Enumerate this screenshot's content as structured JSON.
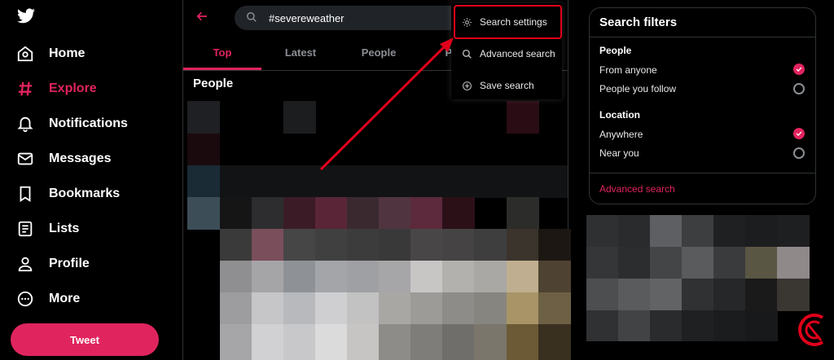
{
  "nav": {
    "items": [
      {
        "label": "Home",
        "icon": "home-icon"
      },
      {
        "label": "Explore",
        "icon": "hashtag-icon",
        "active": true
      },
      {
        "label": "Notifications",
        "icon": "bell-icon"
      },
      {
        "label": "Messages",
        "icon": "envelope-icon"
      },
      {
        "label": "Bookmarks",
        "icon": "bookmark-icon"
      },
      {
        "label": "Lists",
        "icon": "list-icon"
      },
      {
        "label": "Profile",
        "icon": "profile-icon"
      },
      {
        "label": "More",
        "icon": "more-icon"
      }
    ],
    "tweet_label": "Tweet"
  },
  "search": {
    "value": "#severeweather"
  },
  "tabs": [
    {
      "label": "Top",
      "active": true
    },
    {
      "label": "Latest"
    },
    {
      "label": "People"
    },
    {
      "label": "Phot"
    }
  ],
  "main": {
    "section_title": "People"
  },
  "menu": {
    "items": [
      {
        "label": "Search settings",
        "icon": "gear-icon"
      },
      {
        "label": "Advanced search",
        "icon": "search-icon"
      },
      {
        "label": "Save search",
        "icon": "plus-circle-icon"
      }
    ]
  },
  "filters": {
    "title": "Search filters",
    "people_header": "People",
    "people_options": [
      {
        "label": "From anyone",
        "selected": true
      },
      {
        "label": "People you follow",
        "selected": false
      }
    ],
    "location_header": "Location",
    "location_options": [
      {
        "label": "Anywhere",
        "selected": true
      },
      {
        "label": "Near you",
        "selected": false
      }
    ],
    "advanced_link": "Advanced search"
  },
  "colors": {
    "accent": "#e0245e",
    "annotation": "#e0001a",
    "background": "#000000"
  }
}
